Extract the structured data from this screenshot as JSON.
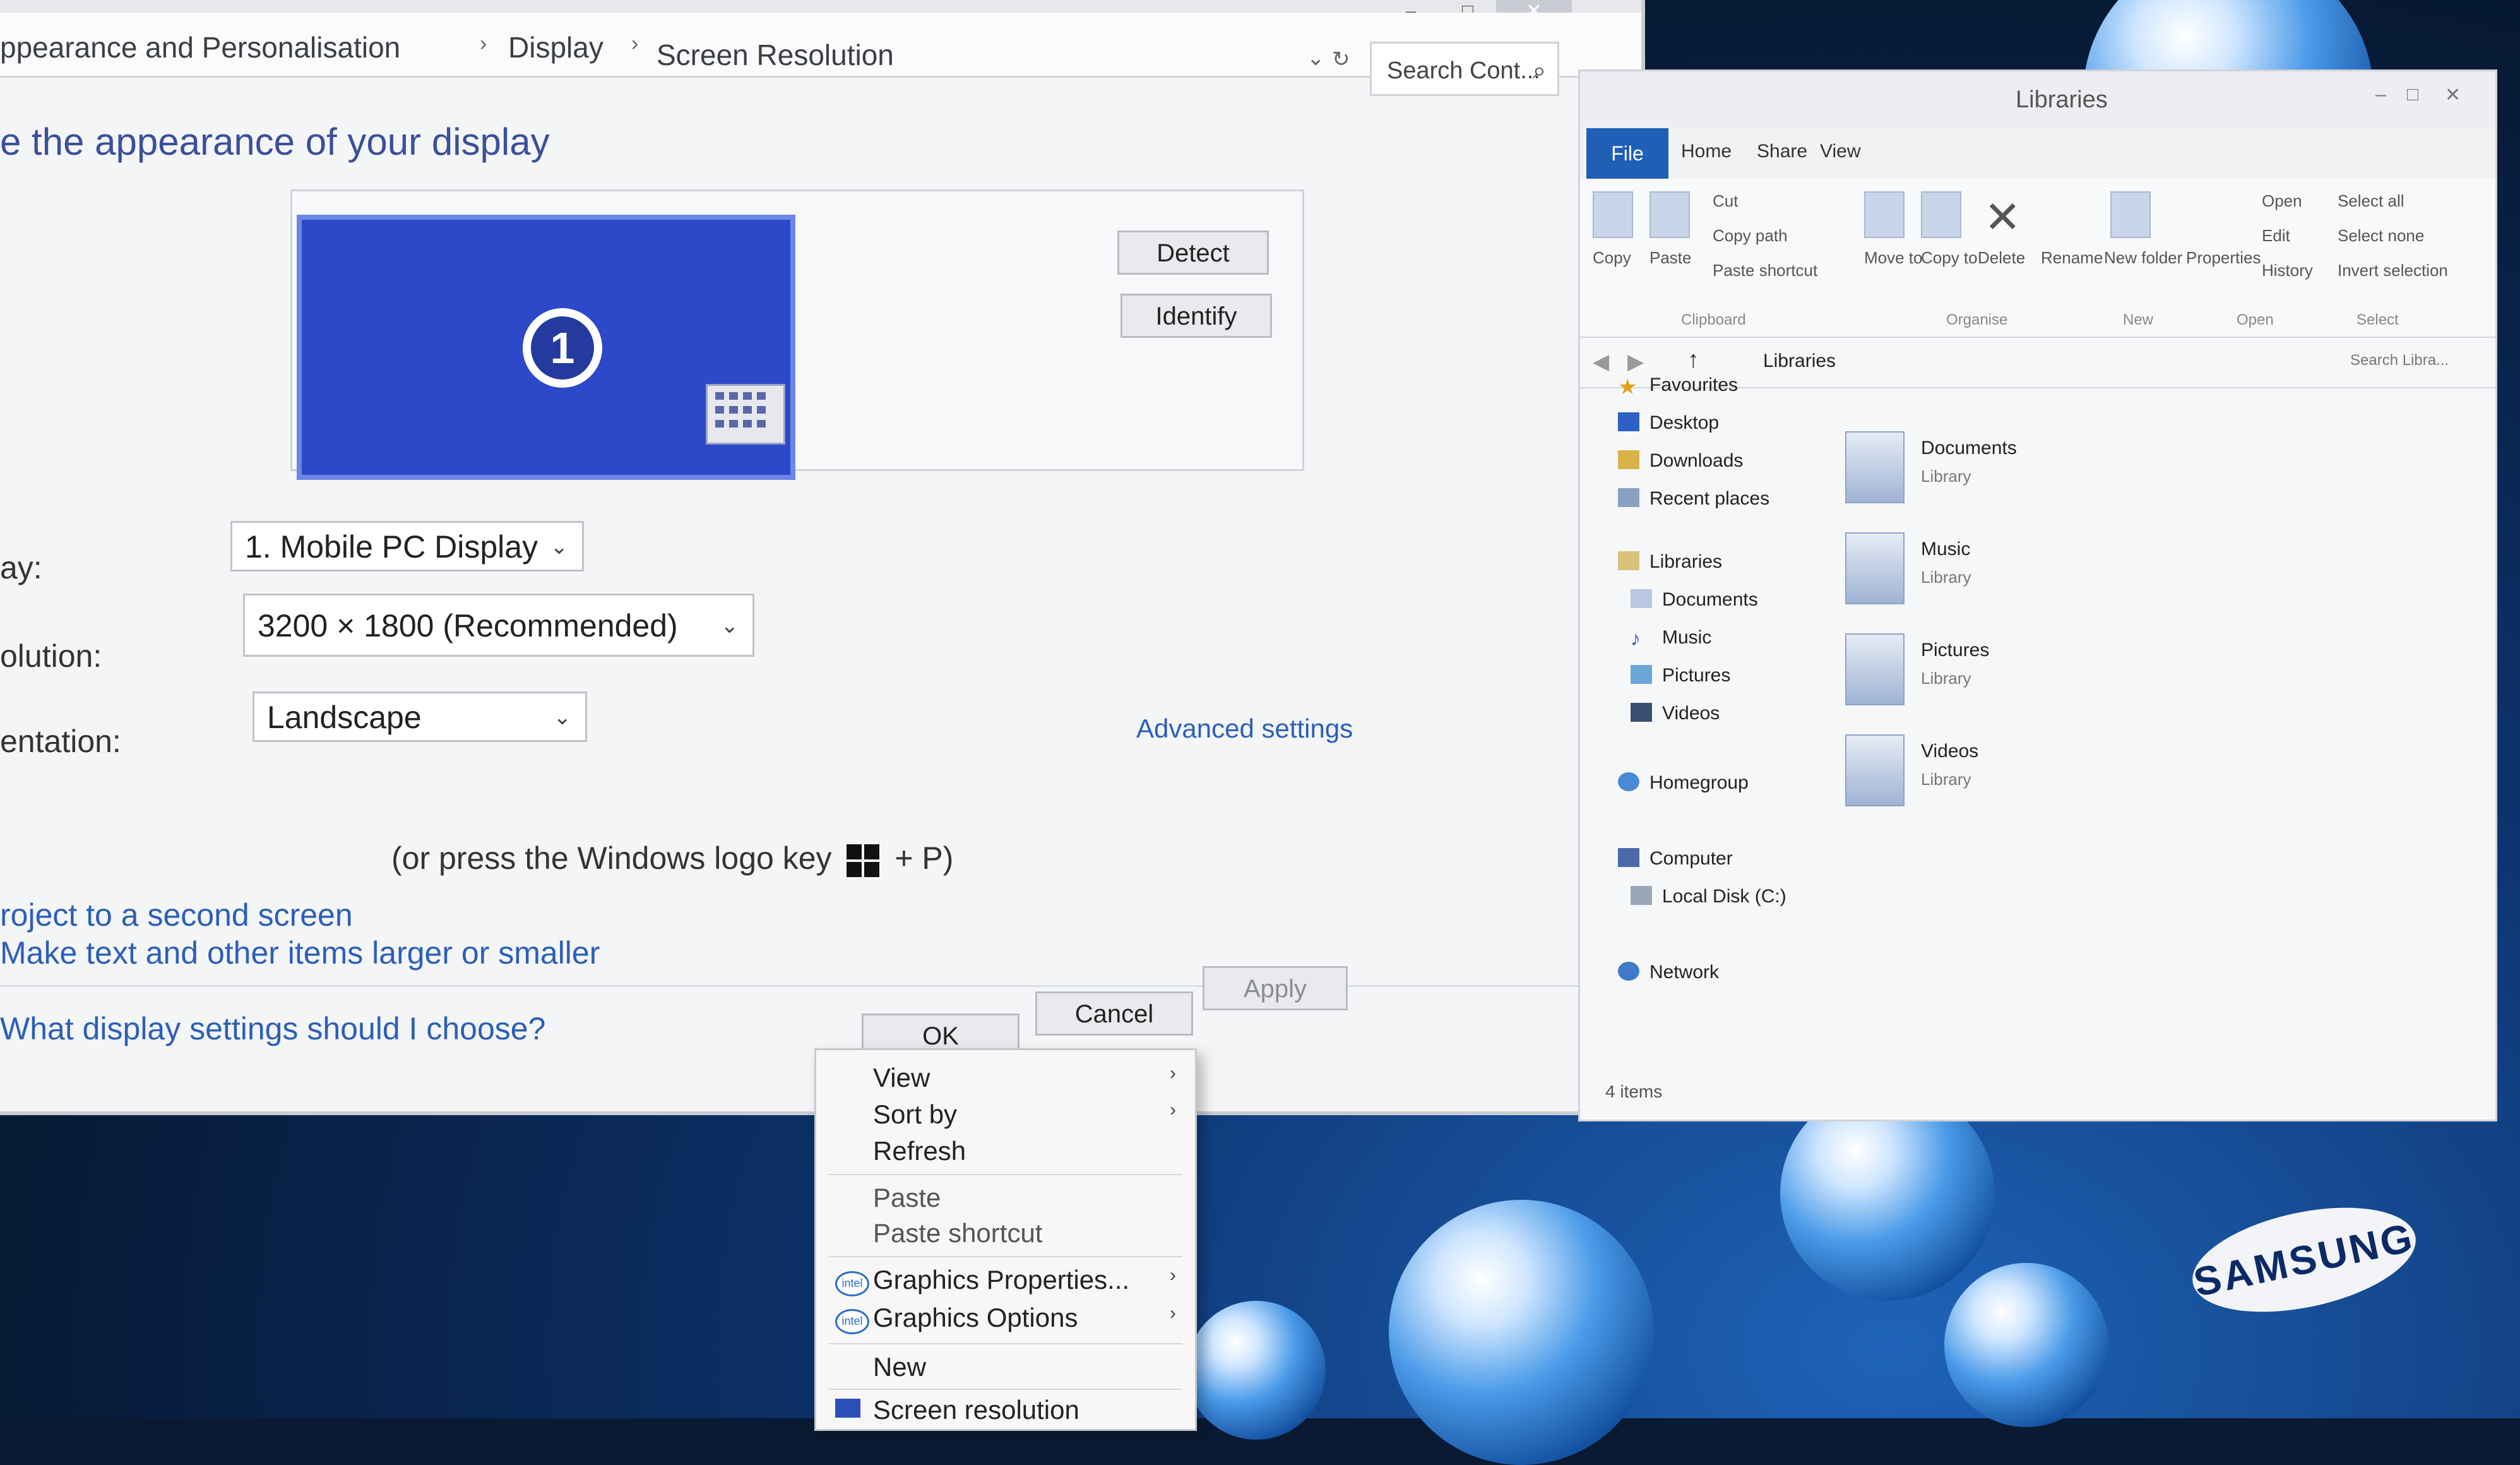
{
  "screen_resolution_window": {
    "breadcrumb": [
      "ppearance and Personalisation",
      "Display",
      "Screen Resolution"
    ],
    "search_placeholder": "Search Cont...",
    "heading": "e the appearance of your display",
    "monitor_number": "1",
    "detect_label": "Detect",
    "identify_label": "Identify",
    "display_label": "ay:",
    "display_value": "1. Mobile PC Display",
    "resolution_label": "olution:",
    "resolution_value": "3200 × 1800 (Recommended)",
    "orientation_label": "entation:",
    "orientation_value": "Landscape",
    "advanced_settings": "Advanced settings",
    "project_link": "roject to a second screen",
    "project_text_before": "(or press the Windows logo key",
    "project_text_after": "+ P)",
    "text_size_link": "Make text and other items larger or smaller",
    "help_link": "What display settings should I choose?",
    "ok_label": "OK",
    "cancel_label": "Cancel",
    "apply_label": "Apply"
  },
  "context_menu": {
    "items": [
      {
        "label": "View",
        "has_submenu": true
      },
      {
        "label": "Sort by",
        "has_submenu": true
      },
      {
        "label": "Refresh"
      },
      {
        "label": "Paste"
      },
      {
        "label": "Paste shortcut"
      },
      {
        "label": "Graphics Properties...",
        "icon": "intel-icon"
      },
      {
        "label": "Graphics Options",
        "icon": "intel-icon",
        "has_submenu": true
      },
      {
        "label": "New",
        "has_submenu": true
      },
      {
        "label": "Screen resolution",
        "icon": "display-icon"
      }
    ]
  },
  "libraries_window": {
    "title": "Libraries",
    "tabs": [
      "File",
      "Home",
      "Share",
      "View"
    ],
    "ribbon": {
      "copy": "Copy",
      "paste": "Paste",
      "cut": "Cut",
      "copy_path": "Copy path",
      "paste_shortcut": "Paste shortcut",
      "move_to": "Move to",
      "copy_to": "Copy to",
      "delete": "Delete",
      "rename": "Rename",
      "new_folder": "New folder",
      "properties": "Properties",
      "open": "Open",
      "edit": "Edit",
      "history": "History",
      "select_all": "Select all",
      "select_none": "Select none",
      "invert_selection": "Invert selection",
      "groups": [
        "Clipboard",
        "Organise",
        "New",
        "Open",
        "Select"
      ]
    },
    "address": "Libraries",
    "search_placeholder": "Search Libra...",
    "nav": [
      {
        "label": "Favourites",
        "icon": "star-icon"
      },
      {
        "label": "Desktop",
        "icon": "desktop-icon"
      },
      {
        "label": "Downloads",
        "icon": "downloads-icon"
      },
      {
        "label": "Recent places",
        "icon": "recent-icon"
      },
      {
        "label": "Libraries",
        "icon": "libraries-icon"
      },
      {
        "label": "Documents",
        "icon": "documents-icon"
      },
      {
        "label": "Music",
        "icon": "music-icon"
      },
      {
        "label": "Pictures",
        "icon": "pictures-icon"
      },
      {
        "label": "Videos",
        "icon": "videos-icon"
      },
      {
        "label": "Homegroup",
        "icon": "homegroup-icon"
      },
      {
        "label": "Computer",
        "icon": "computer-icon"
      },
      {
        "label": "Local Disk (C:)",
        "icon": "disk-icon"
      },
      {
        "label": "Network",
        "icon": "network-icon"
      }
    ],
    "libraries": [
      {
        "name": "Documents",
        "sub": "Library"
      },
      {
        "name": "Music",
        "sub": "Library"
      },
      {
        "name": "Pictures",
        "sub": "Library"
      },
      {
        "name": "Videos",
        "sub": "Library"
      }
    ],
    "status": "4 items"
  },
  "brand": "SAMSUNG",
  "colors": {
    "accent": "#1f5fb6",
    "link": "#2b5fb8",
    "monitor": "#2d48c8"
  }
}
